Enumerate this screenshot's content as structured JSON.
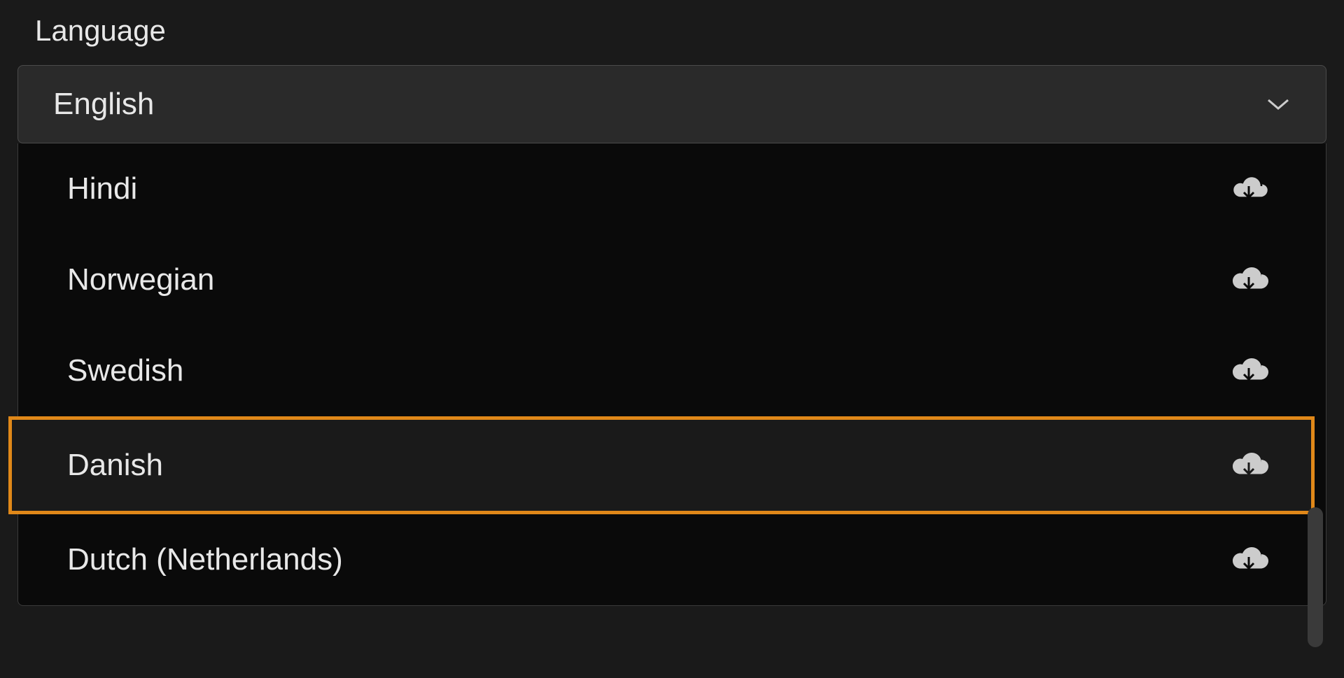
{
  "language": {
    "label": "Language",
    "selected": "English",
    "options": [
      {
        "label": "Hindi",
        "highlighted": false
      },
      {
        "label": "Norwegian",
        "highlighted": false
      },
      {
        "label": "Swedish",
        "highlighted": false
      },
      {
        "label": "Danish",
        "highlighted": true
      },
      {
        "label": "Dutch (Netherlands)",
        "highlighted": false
      }
    ]
  }
}
